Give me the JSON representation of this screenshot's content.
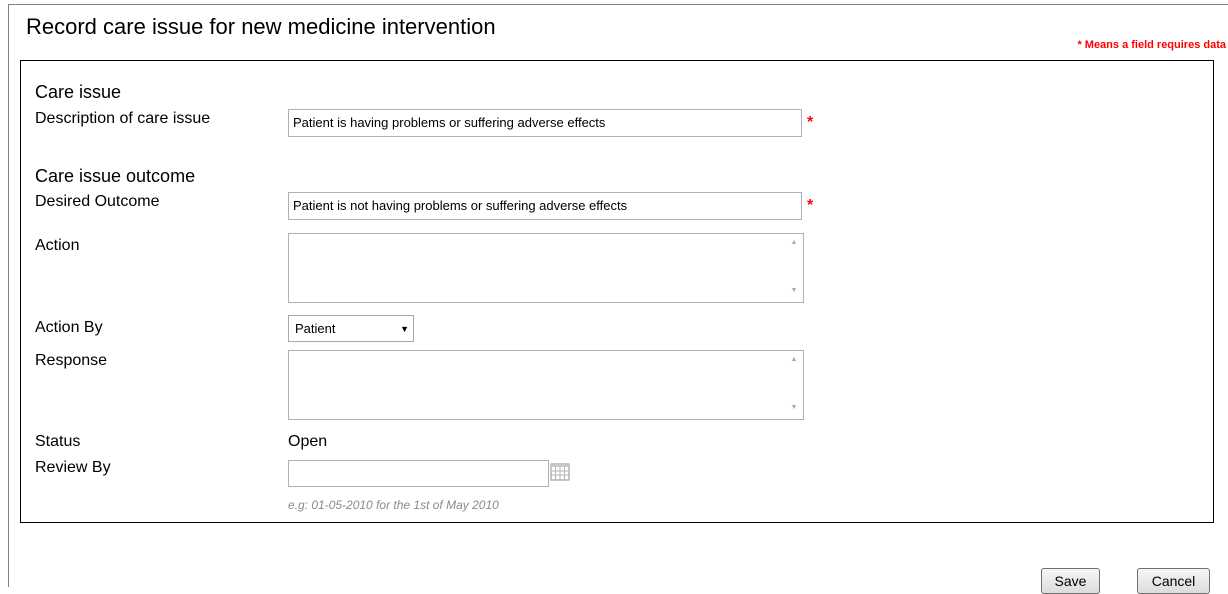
{
  "page": {
    "title": "Record care issue for new medicine intervention",
    "required_note": "* Means a field requires data"
  },
  "care_issue": {
    "heading": "Care issue",
    "description_label": "Description of care issue",
    "description_value": "Patient is having problems or suffering adverse effects",
    "required_marker": "*"
  },
  "outcome": {
    "heading": "Care issue outcome",
    "desired_label": "Desired Outcome",
    "desired_value": "Patient is not having problems or suffering adverse effects",
    "required_marker": "*",
    "action_label": "Action",
    "action_value": "",
    "action_by_label": "Action By",
    "action_by_value": "Patient",
    "response_label": "Response",
    "response_value": "",
    "status_label": "Status",
    "status_value": "Open",
    "review_by_label": "Review By",
    "review_by_value": "",
    "review_by_hint": "e.g: 01-05-2010 for the 1st of May 2010"
  },
  "buttons": {
    "save": "Save",
    "cancel": "Cancel"
  },
  "icons": {
    "calendar": "calendar-icon",
    "dropdown": "chevron-down-icon",
    "scroll_up": "scroll-up-icon",
    "scroll_down": "scroll-down-icon"
  },
  "colors": {
    "required": "#ff0000",
    "hint": "#8a8a8a"
  }
}
